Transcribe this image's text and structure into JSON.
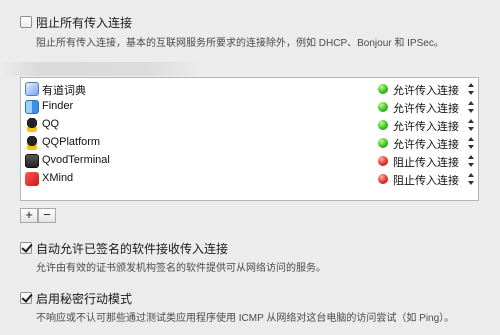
{
  "block_all": {
    "label": "阻止所有传入连接",
    "description": "阻止所有传入连接，基本的互联网服务所要求的连接除外，例如 DHCP、Bonjour 和 IPSec。",
    "checked": false
  },
  "apps": [
    {
      "name": "有道词典",
      "status": "允许传入连接",
      "icon": "youdao-dict-icon",
      "state": "allow"
    },
    {
      "name": "Finder",
      "status": "允许传入连接",
      "icon": "finder-icon",
      "state": "allow"
    },
    {
      "name": "QQ",
      "status": "允许传入连接",
      "icon": "qq-icon",
      "state": "allow"
    },
    {
      "name": "QQPlatform",
      "status": "允许传入连接",
      "icon": "qq-icon",
      "state": "allow"
    },
    {
      "name": "QvodTerminal",
      "status": "阻止传入连接",
      "icon": "qvod-icon",
      "state": "block"
    },
    {
      "name": "XMind",
      "status": "阻止传入连接",
      "icon": "xmind-icon",
      "state": "block"
    }
  ],
  "buttons": {
    "add": "+",
    "remove": "−"
  },
  "auto_allow": {
    "label": "自动允许已签名的软件接收传入连接",
    "description": "允许由有效的证书颁发机构签名的软件提供可从网络访问的服务。",
    "checked": true
  },
  "stealth": {
    "label": "启用秘密行动模式",
    "description": "不响应或不认可那些通过测试类应用程序使用 ICMP 从网络对这台电脑的访问尝试（如 Ping）。",
    "checked": true
  },
  "colors": {
    "allow": "#3bbf21",
    "block": "#e0352a"
  }
}
